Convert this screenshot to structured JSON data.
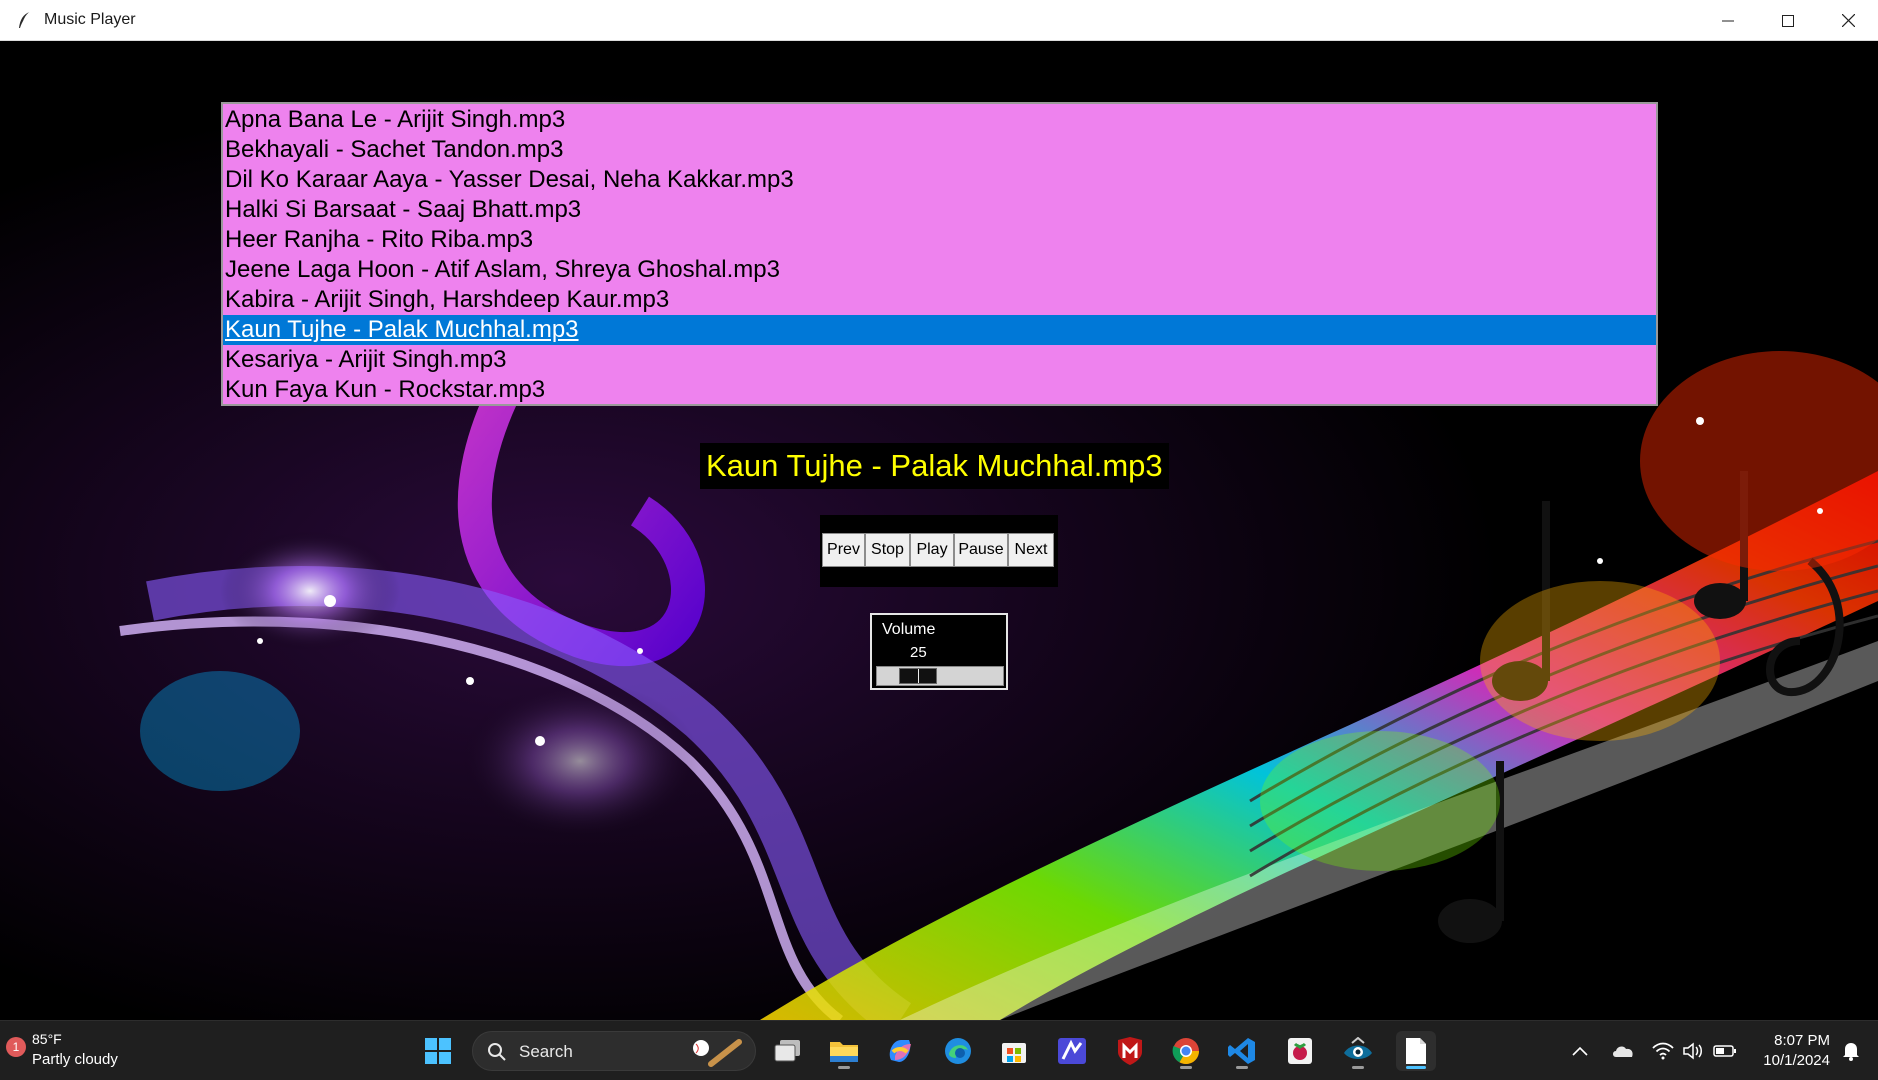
{
  "window": {
    "title": "Music Player",
    "minimize_label": "minimize",
    "maximize_label": "maximize",
    "close_label": "close"
  },
  "playlist": {
    "items": [
      {
        "label": "Apna Bana Le - Arijit Singh.mp3"
      },
      {
        "label": "Bekhayali - Sachet Tandon.mp3"
      },
      {
        "label": "Dil Ko Karaar Aaya - Yasser Desai, Neha Kakkar.mp3"
      },
      {
        "label": "Halki Si Barsaat - Saaj Bhatt.mp3"
      },
      {
        "label": "Heer Ranjha - Rito Riba.mp3"
      },
      {
        "label": "Jeene Laga Hoon - Atif Aslam, Shreya Ghoshal.mp3"
      },
      {
        "label": "Kabira - Arijit Singh, Harshdeep Kaur.mp3"
      },
      {
        "label": "Kaun Tujhe - Palak Muchhal.mp3"
      },
      {
        "label": "Kesariya - Arijit Singh.mp3"
      },
      {
        "label": "Kun Faya Kun - Rockstar.mp3"
      }
    ],
    "selected_index": 7,
    "background_color": "#ee82ee",
    "selection_color": "#0078d7"
  },
  "now_playing": {
    "title": "Kaun Tujhe - Palak Muchhal.mp3",
    "color": "#ffff00"
  },
  "controls": {
    "prev_label": "Prev",
    "stop_label": "Stop",
    "play_label": "Play",
    "pause_label": "Pause",
    "next_label": "Next"
  },
  "volume": {
    "label": "Volume",
    "value": "25",
    "level_percent": 25
  },
  "taskbar": {
    "weather_badge": "1",
    "weather_temp": "85°F",
    "weather_condition": "Partly cloudy",
    "search_placeholder": "Search",
    "apps": [
      "windows-start",
      "search",
      "task-view",
      "file-explorer",
      "copilot",
      "edge",
      "microsoft-store",
      "visual-studio",
      "mcafee",
      "chrome",
      "vscode",
      "raspberry-pi-imager",
      "app-unknown",
      "notepad"
    ],
    "clock_time": "8:07 PM",
    "clock_date": "10/1/2024"
  }
}
